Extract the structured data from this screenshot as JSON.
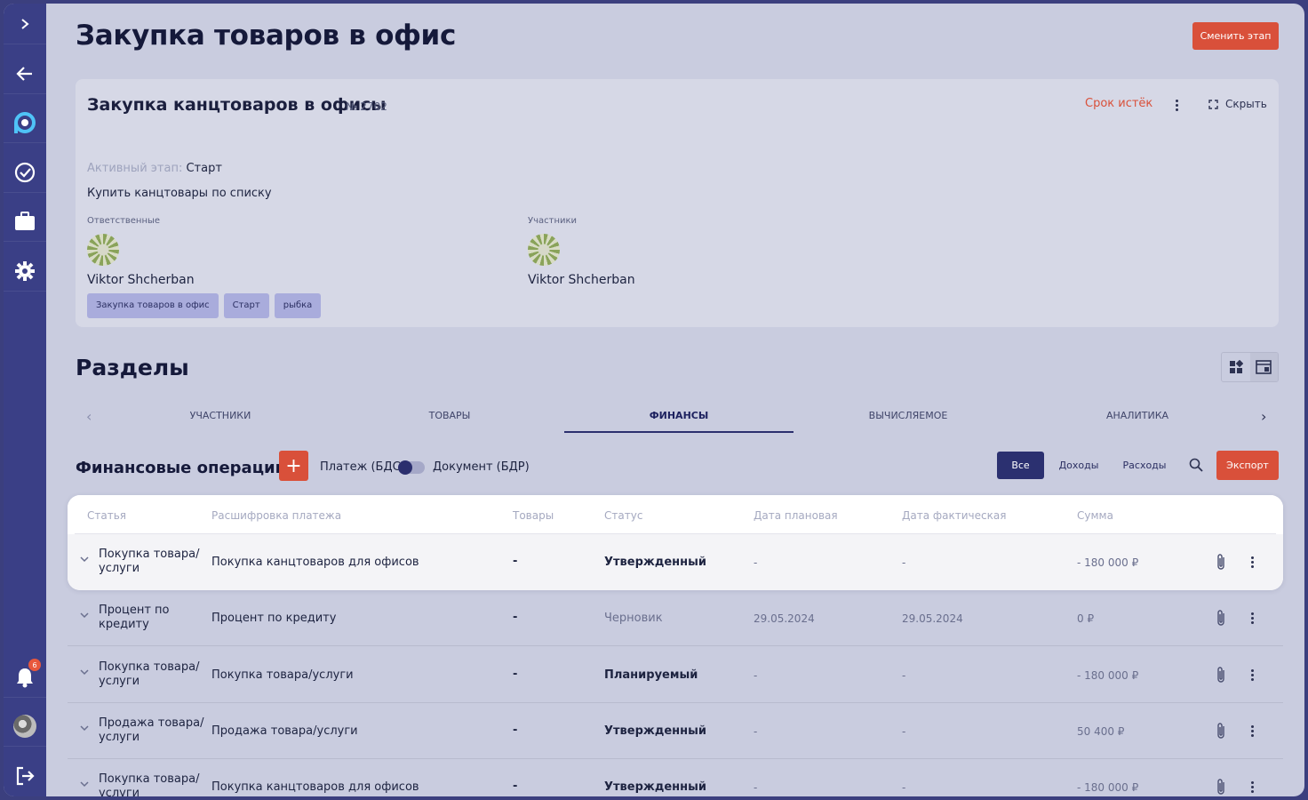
{
  "sidebar": {
    "notifications_count": "6"
  },
  "page": {
    "title": "Закупка товаров в офис",
    "change_stage_label": "Сменить этап"
  },
  "card": {
    "title": "Закупка канцтоваров в офисы",
    "number": "№ 2702",
    "deadline": "Срок истёк",
    "hide_label": "Скрыть",
    "active_stage_label": "Активный этап:",
    "active_stage_value": "Старт",
    "description": "Купить канцтовары по списку",
    "responsible_label": "Ответственные",
    "responsible_name": "Viktor Shcherban",
    "participants_label": "Участники",
    "participant_name": "Viktor Shcherban",
    "tags": [
      "Закупка товаров в офис",
      "Старт",
      "рыбка"
    ]
  },
  "sections": {
    "title": "Разделы",
    "tabs": [
      "УЧАСТНИКИ",
      "ТОВАРЫ",
      "ФИНАНСЫ",
      "ВЫЧИСЛЯЕМОЕ",
      "АНАЛИТИКА"
    ],
    "active_tab": "ФИНАНСЫ"
  },
  "finance": {
    "title": "Финансовые операции",
    "add_label": "+",
    "switch_left": "Платеж (БДС)",
    "switch_right": "Документ (БДР)",
    "filters": [
      "Все",
      "Доходы",
      "Расходы"
    ],
    "active_filter": "Все",
    "export_label": "Экспорт",
    "columns": [
      "Статья",
      "Расшифровка платежа",
      "Товары",
      "Статус",
      "Дата плановая",
      "Дата фактическая",
      "Сумма"
    ],
    "rows": [
      {
        "article": "Покупка товара/\nуслуги",
        "decoding": "Покупка канцтоваров для офисов",
        "goods": "-",
        "status": "Утвержденный",
        "date_plan": "-",
        "date_fact": "-",
        "sum": "- 180 000 ₽"
      },
      {
        "article": "Процент по\nкредиту",
        "decoding": "Процент по кредиту",
        "goods": "-",
        "status": "Черновик",
        "date_plan": "29.05.2024",
        "date_fact": "29.05.2024",
        "sum": "0 ₽"
      },
      {
        "article": "Покупка товара/\nуслуги",
        "decoding": "Покупка товара/услуги",
        "goods": "-",
        "status": "Планируемый",
        "date_plan": "-",
        "date_fact": "-",
        "sum": "- 180 000 ₽"
      },
      {
        "article": "Продажа товара/\nуслуги",
        "decoding": "Продажа товара/услуги",
        "goods": "-",
        "status": "Утвержденный",
        "date_plan": "-",
        "date_fact": "-",
        "sum": "50 400 ₽"
      },
      {
        "article": "Покупка товара/\nуслуги",
        "decoding": "Покупка канцтоваров для офисов",
        "goods": "-",
        "status": "Утвержденный",
        "date_plan": "-",
        "date_fact": "-",
        "sum": "- 180 000 ₽"
      }
    ]
  }
}
